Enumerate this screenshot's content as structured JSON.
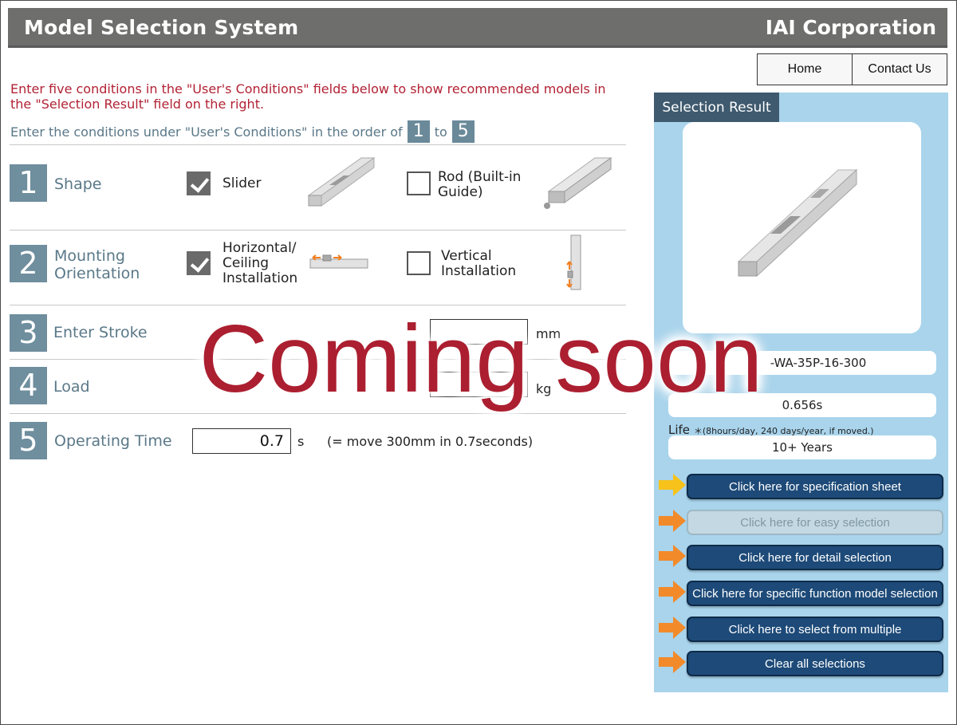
{
  "header": {
    "title": "Model Selection System",
    "corp": "IAI Corporation"
  },
  "nav": {
    "home": "Home",
    "contact": "Contact Us"
  },
  "intro": {
    "line1": "Enter five conditions in the \"User's Conditions\" fields below to show recommended models in the \"Selection Result\" field on the right.",
    "line2_prefix": "Enter the conditions under \"User's Conditions\" in the order of",
    "from": "1",
    "line2_mid": "to",
    "to": "5"
  },
  "steps": {
    "shape": {
      "num": "1",
      "label": "Shape",
      "opt1": "Slider",
      "opt1_checked": true,
      "opt2": "Rod (Built-in Guide)",
      "opt2_checked": false
    },
    "mounting": {
      "num": "2",
      "label": "Mounting Orientation",
      "opt1": "Horizontal/ Ceiling Installation",
      "opt1_checked": true,
      "opt2": "Vertical Installation",
      "opt2_checked": false
    },
    "stroke": {
      "num": "3",
      "label": "Enter Stroke",
      "unit": "mm"
    },
    "load": {
      "num": "4",
      "label": "Load",
      "unit": "kg"
    },
    "time": {
      "num": "5",
      "label": "Operating Time",
      "value": "0.7",
      "unit": "s",
      "note": "(= move 300mm in 0.7seconds)"
    }
  },
  "result": {
    "tab": "Selection Result",
    "model": "-WA-35P-16-300",
    "time": "0.656s",
    "life_label": "Life",
    "life_note": "＊(8hours/day, 240 days/year, if moved.)",
    "life_value": "10+ Years",
    "buttons": [
      "Click here for specification sheet",
      "Click here for easy selection",
      "Click here for detail selection",
      "Click here for specific function model selection",
      "Click here to select from multiple",
      "Clear all selections"
    ]
  },
  "overlay": "Coming soon",
  "colors": {
    "accent_red": "#ab1f30",
    "header_gray": "#6e6e6d",
    "panel_blue": "#a9d4ec",
    "button_navy": "#1d4a78",
    "step_blue": "#6f8e9e"
  }
}
